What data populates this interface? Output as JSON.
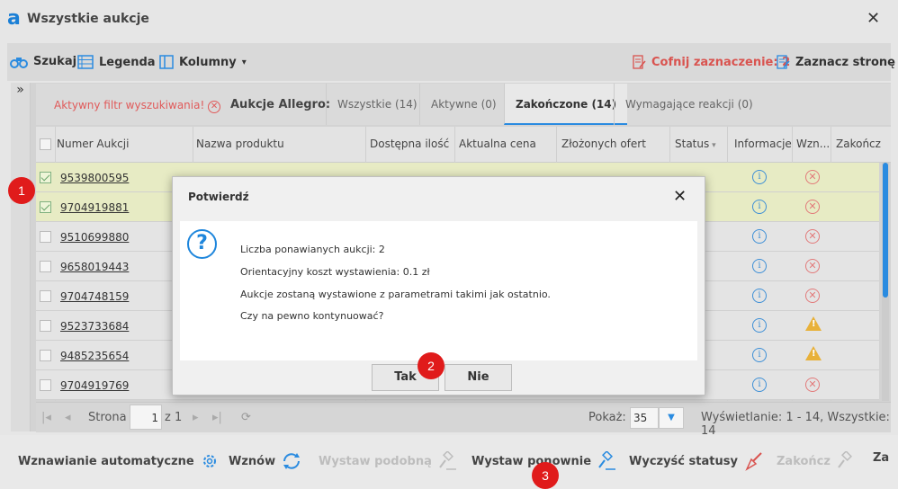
{
  "window": {
    "title": "Wszystkie aukcje",
    "logo_text": "a"
  },
  "toolbar": {
    "search": "Szukaj",
    "legend": "Legenda",
    "columns": "Kolumny",
    "undo_selection": "Cofnij zaznaczenie: 2",
    "select_page": "Zaznacz stronę"
  },
  "filters": {
    "active_filter": "Aktywny filtr wyszukiwania!",
    "tabs_label": "Aukcje Allegro:",
    "tabs": [
      {
        "label": "Wszystkie (14)"
      },
      {
        "label": "Aktywne (0)"
      },
      {
        "label": "Zakończone (14)"
      },
      {
        "label": "Wymagające reakcji (0)"
      }
    ]
  },
  "table": {
    "columns": [
      "Numer Aukcji",
      "Nazwa produktu",
      "Dostępna ilość",
      "Aktualna cena",
      "Złożonych ofert",
      "Status",
      "Informacje",
      "Wzn...",
      "Zakończ"
    ],
    "rows": [
      {
        "number": "9539800595",
        "checked": true,
        "status": "x"
      },
      {
        "number": "9704919881",
        "checked": true,
        "status": "x"
      },
      {
        "number": "9510699880",
        "checked": false,
        "status": "x"
      },
      {
        "number": "9658019443",
        "checked": false,
        "status": "x"
      },
      {
        "number": "9704748159",
        "checked": false,
        "status": "x"
      },
      {
        "number": "9523733684",
        "checked": false,
        "status": "warn"
      },
      {
        "number": "9485235654",
        "checked": false,
        "status": "warn"
      },
      {
        "number": "9704919769",
        "checked": false,
        "status": "x"
      }
    ]
  },
  "pager": {
    "page_label": "Strona",
    "page_value": "1",
    "of_label": "z 1",
    "show_label": "Pokaż:",
    "show_value": "35",
    "summary": "Wyświetlanie: 1 - 14, Wszystkie: 14"
  },
  "bottom": {
    "auto_resume": "Wznawianie automatyczne",
    "resume": "Wznów",
    "list_similar": "Wystaw podobną",
    "list_again": "Wystaw ponownie",
    "clear_statuses": "Wyczyść statusy",
    "end": "Zakończ",
    "more": "Za"
  },
  "dialog": {
    "title": "Potwierdź",
    "lines": [
      "Liczba ponawianych aukcji: 2",
      "Orientacyjny koszt wystawienia: 0.1 zł",
      "Aukcje zostaną wystawione z parametrami takimi jak ostatnio.",
      "Czy na pewno kontynuować?"
    ],
    "yes": "Tak",
    "no": "Nie"
  },
  "badges": [
    "1",
    "2",
    "3"
  ],
  "colors": {
    "accent": "#2a8be0",
    "badge": "#e01b1b",
    "selected_row": "#e7ebc4"
  }
}
